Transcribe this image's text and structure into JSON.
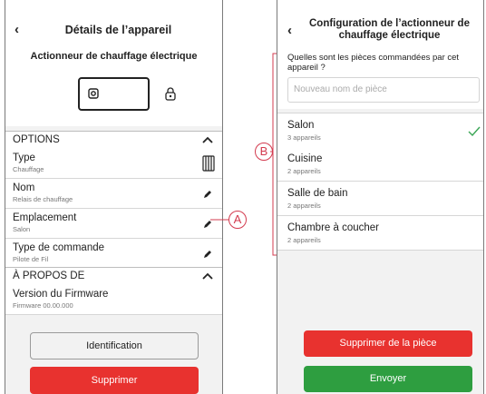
{
  "left_screen": {
    "title": "Détails de l’appareil",
    "device_name": "Actionneur de chauffage électrique",
    "sections": {
      "options": "OPTIONS",
      "about": "À PROPOS DE"
    },
    "rows": [
      {
        "title": "Type",
        "subtitle": "Chauffage"
      },
      {
        "title": "Nom",
        "subtitle": "Relais de chauffage"
      },
      {
        "title": "Emplacement",
        "subtitle": "Salon"
      },
      {
        "title": "Type de commande",
        "subtitle": "Pilote de Fil"
      }
    ],
    "firmware": {
      "title": "Version du Firmware",
      "subtitle": "Firmware 00.00.000"
    },
    "identify_label": "Identification",
    "delete_label": "Supprimer"
  },
  "right_screen": {
    "title_line1": "Configuration de l’actionneur de",
    "title_line2": "chauffage électrique",
    "question": "Quelles sont les pièces commandées par cet appareil ?",
    "new_room_placeholder": "Nouveau nom de pièce",
    "rooms": [
      {
        "name": "Salon",
        "count": "3 appareils",
        "selected": true
      },
      {
        "name": "Cuisine",
        "count": "2 appareils",
        "selected": false
      },
      {
        "name": "Salle de bain",
        "count": "2 appareils",
        "selected": false
      },
      {
        "name": "Chambre à coucher",
        "count": "2 appareils",
        "selected": false
      }
    ],
    "delete_room_label": "Supprimer de la pièce",
    "send_label": "Envoyer"
  },
  "callouts": {
    "a": "A",
    "b": "B"
  },
  "colors": {
    "red": "#e8322f",
    "green": "#2e9e40",
    "check": "#3aa655",
    "callout": "#d33b4f"
  }
}
